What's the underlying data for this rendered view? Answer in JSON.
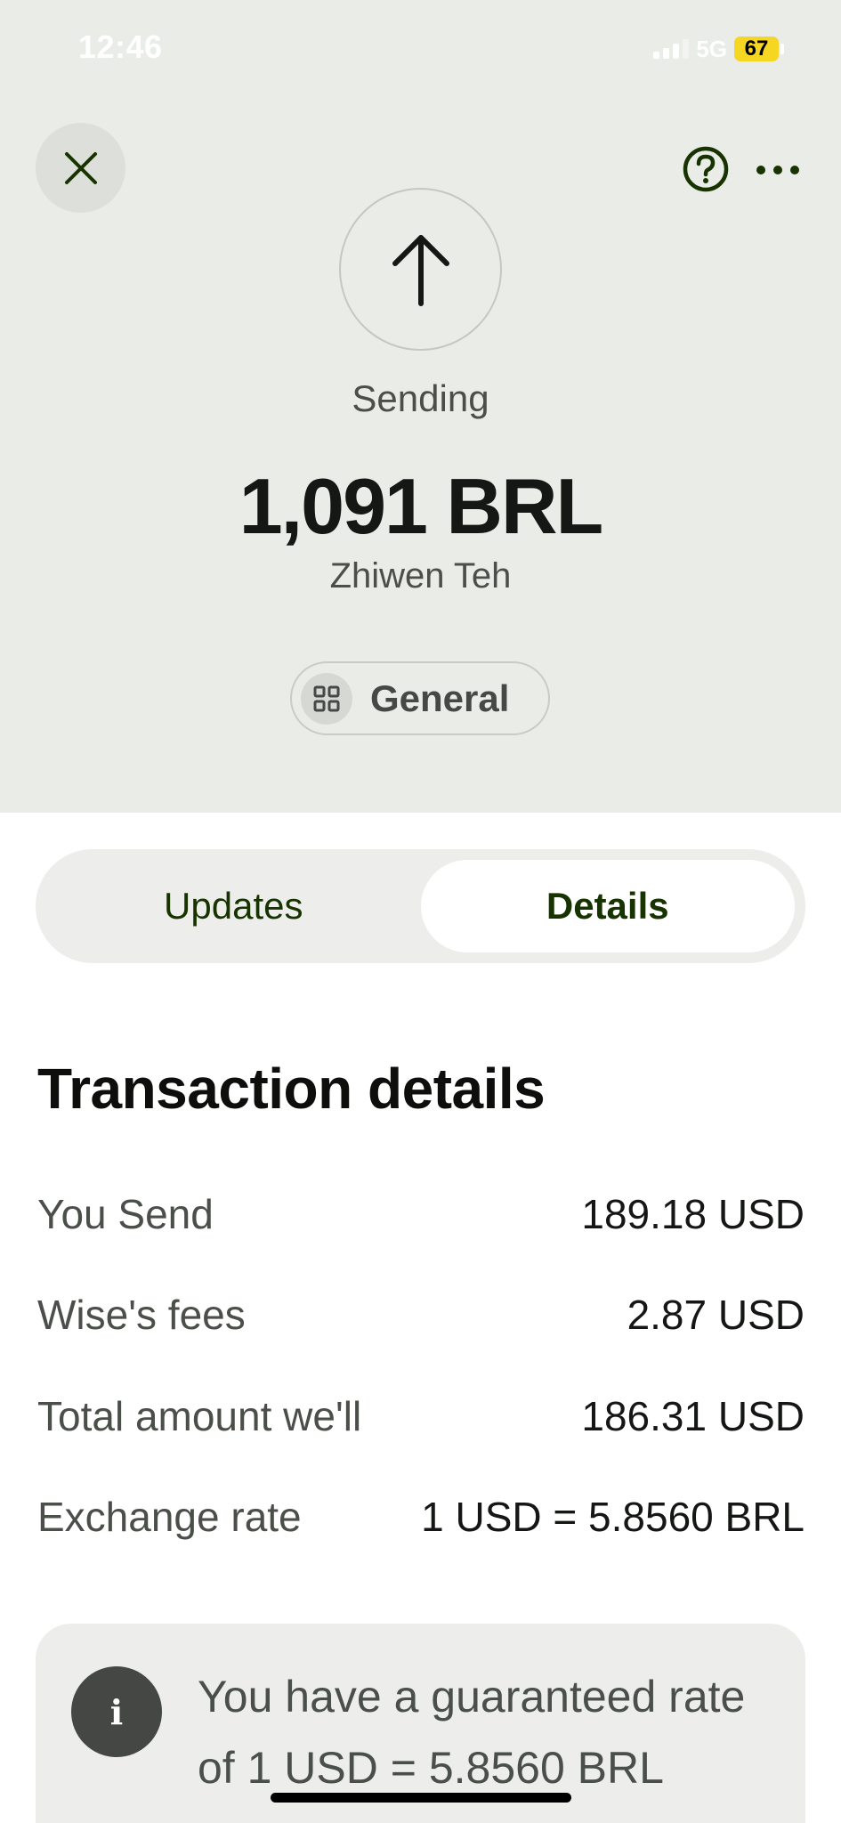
{
  "status_bar": {
    "time": "12:46",
    "network": "5G",
    "battery": "67",
    "battery_color": "#f5d622"
  },
  "header": {
    "close_icon": "close-icon",
    "help_icon": "help-circle-icon",
    "more_icon": "more-horizontal-icon"
  },
  "transfer": {
    "icon": "arrow-up-icon",
    "status": "Sending",
    "amount": "1,091 BRL",
    "recipient": "Zhiwen Teh",
    "category": "General",
    "category_icon": "grid-icon"
  },
  "tabs": [
    {
      "label": "Updates",
      "active": false
    },
    {
      "label": "Details",
      "active": true
    }
  ],
  "details": {
    "title": "Transaction details",
    "rows": [
      {
        "label": "You Send",
        "value": "189.18 USD"
      },
      {
        "label": "Wise's fees",
        "value": "2.87 USD"
      },
      {
        "label": "Total amount we'll",
        "value": "186.31 USD"
      },
      {
        "label": "Exchange rate",
        "value": "1 USD = 5.8560 BRL"
      }
    ]
  },
  "info_card": {
    "icon": "info-icon",
    "icon_glyph": "i",
    "text": "You have a guaranteed rate of 1 USD = 5.8560 BRL"
  },
  "colors": {
    "header_bg": "#eaece8",
    "accent_text": "#163300",
    "primary_text": "#141714"
  }
}
